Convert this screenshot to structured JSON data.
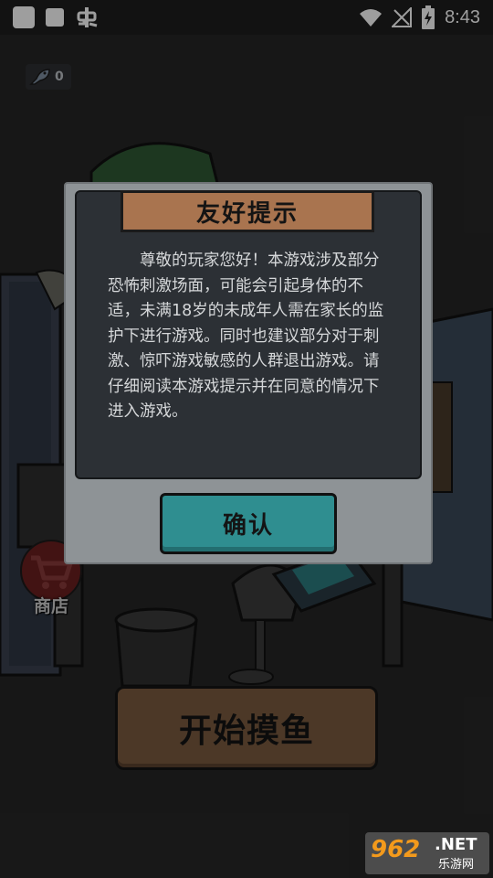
{
  "status_bar": {
    "time": "8:43",
    "icons": [
      "square-icon",
      "square-icon",
      "bug-icon",
      "wifi-icon",
      "no-signal-icon",
      "battery-charging-icon"
    ]
  },
  "hud": {
    "fish_count": "0"
  },
  "shop": {
    "label": "商店"
  },
  "start_button": {
    "label": "开始摸鱼"
  },
  "dialog": {
    "title": "友好提示",
    "body": "　　尊敬的玩家您好！本游戏涉及部分恐怖刺激场面，可能会引起身体的不适，未满18岁的未成年人需在家长的监护下进行游戏。同时也建议部分对于刺激、惊吓游戏敏感的人群退出游戏。请仔细阅读本游戏提示并在同意的情况下进入游戏。",
    "confirm_label": "确认"
  },
  "watermark": {
    "number": "962",
    "domain": ".NET",
    "subtitle": "乐游网"
  },
  "colors": {
    "panel_frame": "#8e9396",
    "panel_inner": "#2c3035",
    "title_banner": "#a9744f",
    "confirm_button": "#2f8e90",
    "start_button": "#7b5b3f"
  }
}
